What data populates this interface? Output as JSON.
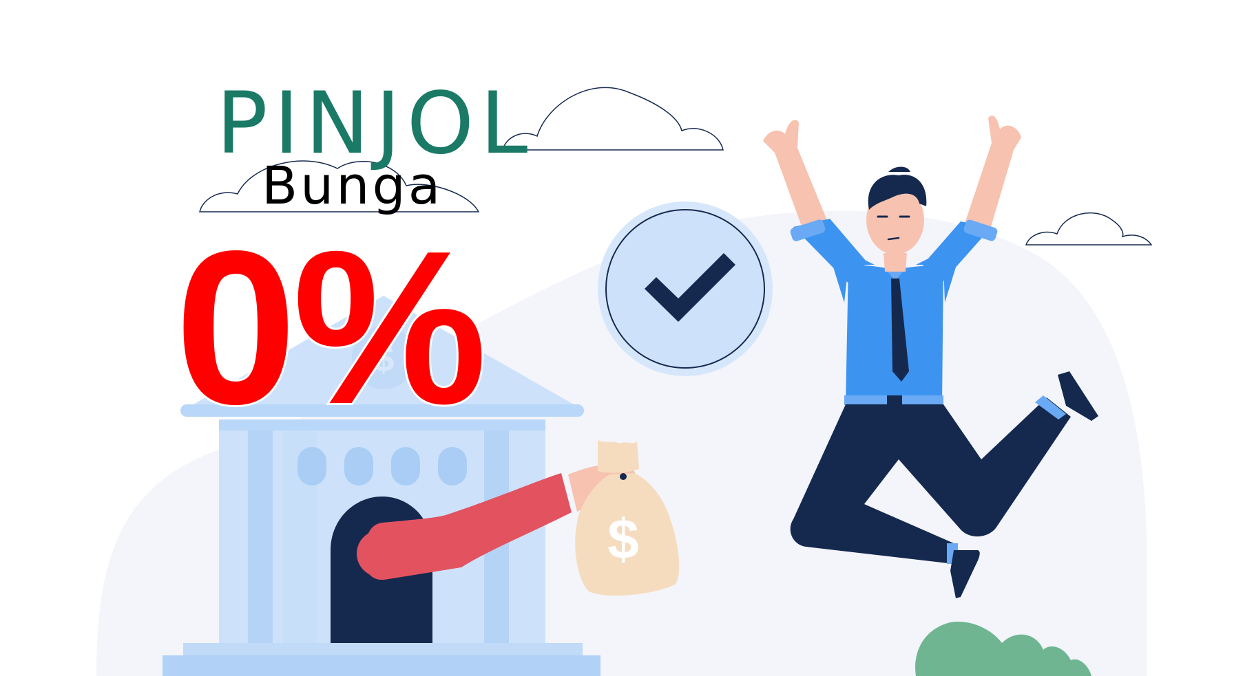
{
  "headline": {
    "title": "PINJOL",
    "subtitle": "Bunga",
    "rate": "0%"
  },
  "illustration": {
    "coin_symbol": "$",
    "bag_symbol": "$",
    "colors": {
      "title": "#1a7a66",
      "rate": "#ff0000",
      "bank": "#c8dffa",
      "bank_dark": "#a9cdf5",
      "navy": "#15294f",
      "shirt": "#3d93f0",
      "sleeve": "#e2535f",
      "skin": "#f7c2b0",
      "bag": "#f6dcbf",
      "bush": "#6fb592",
      "backdrop": "#f3f5fb"
    },
    "icons": [
      "check-icon",
      "bank-icon",
      "money-bag-icon",
      "cloud-icon",
      "dollar-icon"
    ]
  }
}
